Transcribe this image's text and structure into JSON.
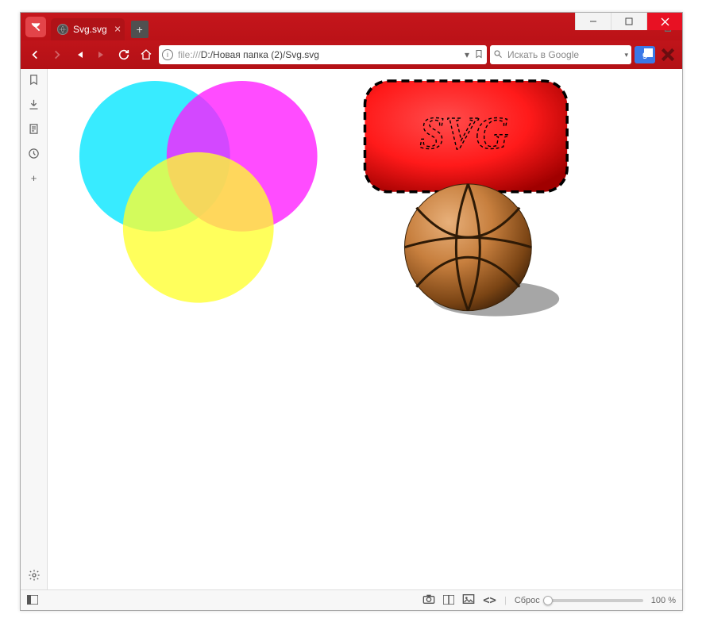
{
  "tab": {
    "title": "Svg.svg"
  },
  "url": {
    "protocol": "file:///",
    "path": "D:/Новая папка (2)/Svg.svg"
  },
  "search": {
    "placeholder": "Искать в Google"
  },
  "svg_text": "SVG",
  "status": {
    "reset_label": "Сброс",
    "zoom_label": "100 %"
  }
}
